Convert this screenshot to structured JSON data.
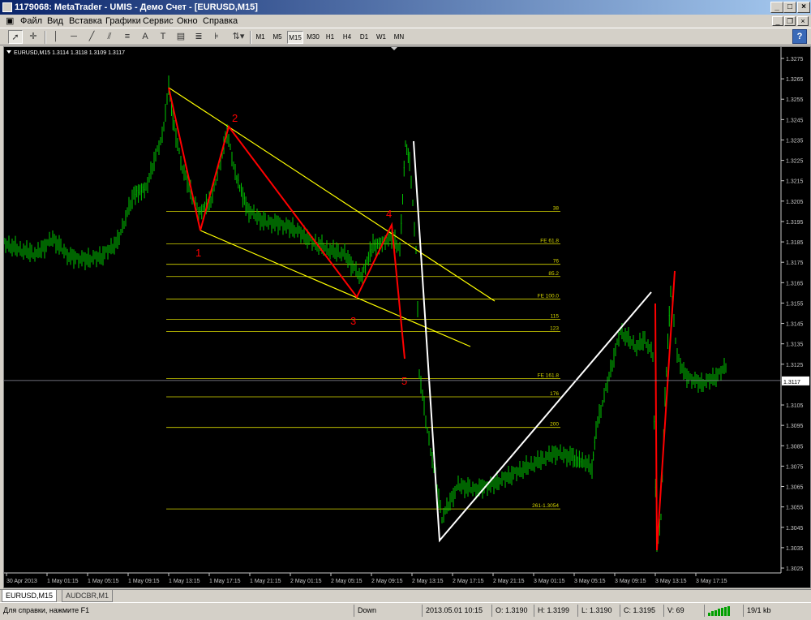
{
  "window": {
    "title": "1179068: MetaTrader - UMIS - Демо Счет - [EURUSD,M15]"
  },
  "menu": {
    "items": [
      "Файл",
      "Вид",
      "Вставка",
      "Графики",
      "Сервис",
      "Окно",
      "Справка"
    ]
  },
  "toolbar": {
    "timeframes": [
      "M1",
      "M5",
      "M15",
      "M30",
      "H1",
      "H4",
      "D1",
      "W1",
      "MN"
    ],
    "active_timeframe": "M15",
    "text_tool": "A",
    "help_icon": "?"
  },
  "chart": {
    "info": "EURUSD,M15  1.3114 1.3118 1.3109 1.3117",
    "current_price": "1.3117",
    "colors": {
      "candle": "#00c800",
      "fibo": "#d8d800",
      "channel": "#ffff00",
      "wave": "#ff0000",
      "zigzag": "#ffffff",
      "bg": "#000000"
    },
    "price_labels": [
      "1.3275",
      "1.3265",
      "1.3255",
      "1.3245",
      "1.3235",
      "1.3225",
      "1.3215",
      "1.3205",
      "1.3195",
      "1.3185",
      "1.3175",
      "1.3165",
      "1.3155",
      "1.3145",
      "1.3135",
      "1.3125",
      "1.3105",
      "1.3095",
      "1.3085",
      "1.3075",
      "1.3065",
      "1.3055",
      "1.3045",
      "1.3035",
      "1.3025"
    ],
    "time_labels": [
      "30 Apr 2013",
      "1 May 01:15",
      "1 May 05:15",
      "1 May 09:15",
      "1 May 13:15",
      "1 May 17:15",
      "1 May 21:15",
      "2 May 01:15",
      "2 May 05:15",
      "2 May 09:15",
      "2 May 13:15",
      "2 May 17:15",
      "2 May 21:15",
      "3 May 01:15",
      "3 May 05:15",
      "3 May 09:15",
      "3 May 13:15",
      "3 May 17:15"
    ],
    "fibo_levels": [
      {
        "label": "38",
        "price": 1.32
      },
      {
        "label": "FE 61.8",
        "price": 1.3184
      },
      {
        "label": "76",
        "price": 1.3174
      },
      {
        "label": "85.2",
        "price": 1.3168
      },
      {
        "label": "FE 100.0",
        "price": 1.3157
      },
      {
        "label": "115",
        "price": 1.3147
      },
      {
        "label": "123",
        "price": 1.3141
      },
      {
        "label": "FE 161.8",
        "price": 1.3118
      },
      {
        "label": "176",
        "price": 1.3109
      },
      {
        "label": "200",
        "price": 1.3094
      },
      {
        "label": "261-1.3054",
        "price": 1.3054
      }
    ],
    "wave_labels": [
      "1",
      "2",
      "3",
      "4",
      "5"
    ]
  },
  "tabs": [
    "EURUSD,M15",
    "AUDCBR,M1"
  ],
  "status": {
    "help": "Для справки, нажмите F1",
    "profile": "Down",
    "datetime": "2013.05.01 10:15",
    "open": "O: 1.3190",
    "high": "H: 1.3199",
    "low": "L: 1.3190",
    "close": "C: 1.3195",
    "volume": "V: 69",
    "traffic": "19/1 kb"
  }
}
